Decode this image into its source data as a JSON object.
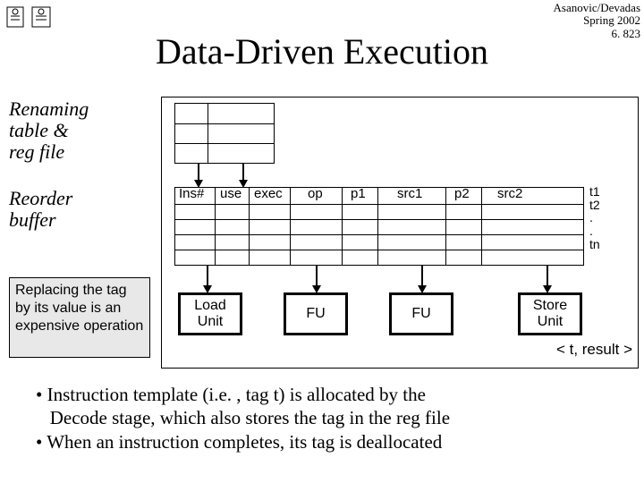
{
  "meta": {
    "authors": "Asanovic/Devadas",
    "term": "Spring 2002",
    "course": "6. 823"
  },
  "title": "Data-Driven Execution",
  "labels": {
    "rename": "Renaming\ntable &\nreg file",
    "reorder": "Reorder\nbuffer"
  },
  "note": "Replacing the tag by its value is an expensive operation",
  "rob_headers": {
    "ins": "Ins#",
    "use": "use",
    "exec": "exec",
    "op": "op",
    "p1": "p1",
    "src1": "src1",
    "p2": "p2",
    "src2": "src2"
  },
  "tags": {
    "t1": "t1",
    "t2": "t2",
    "dot1": ".",
    "dot2": ".",
    "tn": "tn"
  },
  "units": {
    "load": "Load\nUnit",
    "fu1": "FU",
    "fu2": "FU",
    "store": "Store\nUnit"
  },
  "result": "< t, result >",
  "bullets": {
    "l1": "• Instruction template (i.e. , tag t) is allocated by the",
    "l2": "   Decode stage, which also stores the tag in the reg file",
    "l3": "• When an instruction completes, its tag is deallocated"
  }
}
